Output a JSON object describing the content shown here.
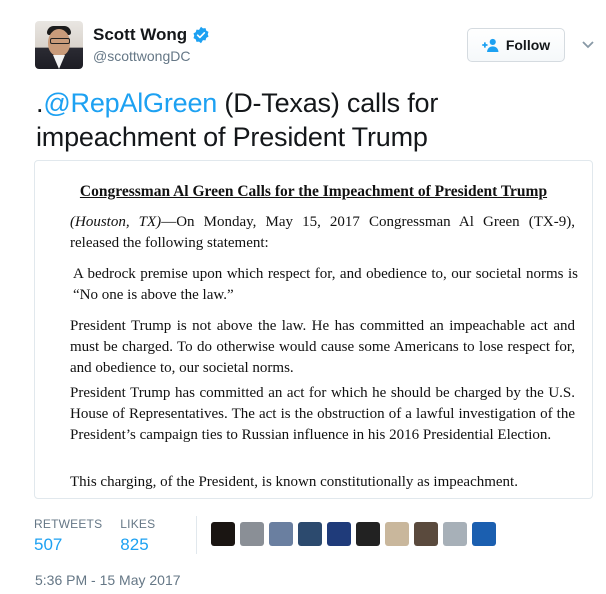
{
  "author": {
    "name": "Scott Wong",
    "handle": "@scottwongDC",
    "verified": true,
    "avatar_icon": "avatar-photo"
  },
  "follow_button": {
    "label": "Follow",
    "icon": "add-user-icon"
  },
  "tweet": {
    "prefix": ".",
    "mention": "@RepAlGreen",
    "text_after": " (D-Texas) calls for impeachment of President Trump",
    "mention_color": "#1da1f2"
  },
  "document": {
    "title": "Congressman Al Green Calls for the Impeachment of President Trump",
    "location": "(Houston, TX)",
    "p1_rest": "—On Monday, May 15, 2017 Congressman Al Green (TX-9), released the following statement:",
    "p2": "A bedrock premise upon which respect for, and obedience to, our societal norms is “No one is above the law.”",
    "p3": "President Trump is not above the law.  He has committed an impeachable act and must be charged.  To do otherwise would cause some Americans to lose respect for, and obedience to, our societal norms.",
    "p4": "President Trump has committed an act for which he should be charged by the U.S. House of Representatives.  The act is the obstruction of a lawful investigation of the President’s campaign ties to Russian influence in his 2016 Presidential Election.",
    "p5": "This charging, of the President, is known constitutionally as impeachment."
  },
  "stats": {
    "retweets_label": "RETWEETS",
    "retweets_value": "507",
    "likes_label": "LIKES",
    "likes_value": "825"
  },
  "likers": [
    {
      "name": "liker-avatar-1",
      "color": "#1a1512"
    },
    {
      "name": "liker-avatar-2",
      "color": "#8a8f96"
    },
    {
      "name": "liker-avatar-3",
      "color": "#6a7fa0"
    },
    {
      "name": "liker-avatar-4",
      "color": "#2c4a6e"
    },
    {
      "name": "liker-avatar-5",
      "color": "#1f3b7a"
    },
    {
      "name": "liker-avatar-6",
      "color": "#222222"
    },
    {
      "name": "liker-avatar-7",
      "color": "#c9b79c"
    },
    {
      "name": "liker-avatar-8",
      "color": "#5a4a3d"
    },
    {
      "name": "liker-avatar-9",
      "color": "#a7b0b8"
    },
    {
      "name": "liker-avatar-10",
      "color": "#1b5fb0"
    }
  ],
  "timestamp": "5:36 PM - 15 May 2017"
}
